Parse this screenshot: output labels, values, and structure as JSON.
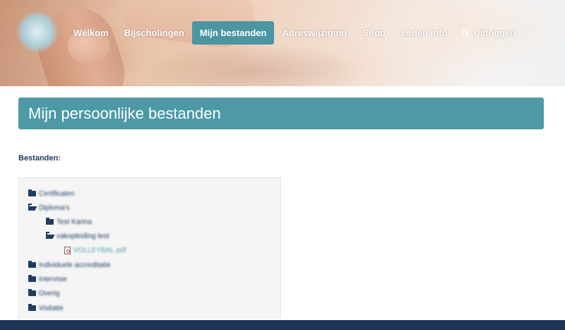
{
  "nav": {
    "items": [
      {
        "label": "Welkom",
        "active": false
      },
      {
        "label": "Bijscholingen",
        "active": false
      },
      {
        "label": "Mijn bestanden",
        "active": true
      },
      {
        "label": "Adreswijziging",
        "active": false
      },
      {
        "label": "Shop",
        "active": false
      },
      {
        "label": "Leden info",
        "active": false
      },
      {
        "label": "Uitloggen",
        "active": false,
        "icon": "logout-icon"
      }
    ]
  },
  "page": {
    "title": "Mijn persoonlijke bestanden",
    "files_label": "Bestanden:"
  },
  "tree": {
    "items": [
      {
        "label": "Certificaten",
        "type": "folder",
        "level": 0
      },
      {
        "label": "Diploma's",
        "type": "folder-open",
        "level": 0
      },
      {
        "label": "Test Karina",
        "type": "folder",
        "level": 1
      },
      {
        "label": "vakopleiding test",
        "type": "folder-open",
        "level": 1
      },
      {
        "label": "VOLLEYBAL.pdf",
        "type": "pdf",
        "level": 2
      },
      {
        "label": "Individuele accreditatie",
        "type": "folder",
        "level": 0
      },
      {
        "label": "Intervisie",
        "type": "folder",
        "level": 0
      },
      {
        "label": "Overig",
        "type": "folder",
        "level": 0
      },
      {
        "label": "Visitatie",
        "type": "folder",
        "level": 0
      }
    ]
  },
  "colors": {
    "accent": "#4e99a6",
    "nav_active": "#4a96a3",
    "text_dark": "#1f3d64",
    "footer": "#1d3557"
  }
}
